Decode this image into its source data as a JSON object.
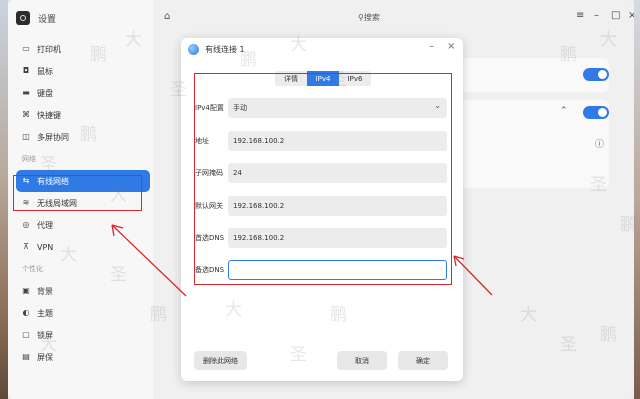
{
  "app": {
    "title": "设置"
  },
  "sidebar": {
    "items": [
      {
        "label": "打印机",
        "icon": "printer-icon",
        "glyph": "▭"
      },
      {
        "label": "鼠标",
        "icon": "mouse-icon",
        "glyph": "◘"
      },
      {
        "label": "键盘",
        "icon": "keyboard-icon",
        "glyph": "▬"
      },
      {
        "label": "快捷键",
        "icon": "shortcut-icon",
        "glyph": "⌘"
      },
      {
        "label": "多屏协同",
        "icon": "multiscreen-icon",
        "glyph": "◫"
      }
    ],
    "group_network": "网络",
    "network_items": [
      {
        "label": "有线网络",
        "icon": "wired-network-icon",
        "glyph": "⇆",
        "active": true
      },
      {
        "label": "无线局域网",
        "icon": "wifi-icon",
        "glyph": "≋"
      },
      {
        "label": "代理",
        "icon": "proxy-icon",
        "glyph": "◎"
      },
      {
        "label": "VPN",
        "icon": "vpn-icon",
        "glyph": "⊼"
      }
    ],
    "group_personal": "个性化",
    "personal_items": [
      {
        "label": "背景",
        "icon": "background-icon",
        "glyph": "▣"
      },
      {
        "label": "主题",
        "icon": "theme-icon",
        "glyph": "◐"
      },
      {
        "label": "锁屏",
        "icon": "lockscreen-icon",
        "glyph": "▢"
      },
      {
        "label": "屏保",
        "icon": "screensaver-icon",
        "glyph": "▤"
      }
    ]
  },
  "topbar": {
    "search_label": "搜索"
  },
  "dialog": {
    "title": "有线连接 1",
    "tabs": [
      "详情",
      "IPv4",
      "IPv6"
    ],
    "selected_tab": "IPv4",
    "fields": [
      {
        "label": "IPv4配置",
        "value": "手动",
        "type": "select"
      },
      {
        "label": "地址",
        "value": "192.168.100.2"
      },
      {
        "label": "子网掩码",
        "value": "24"
      },
      {
        "label": "默认网关",
        "value": "192.168.100.2"
      },
      {
        "label": "首选DNS",
        "value": "192.168.100.2"
      },
      {
        "label": "备选DNS",
        "value": "",
        "active": true
      }
    ],
    "buttons": {
      "delete": "删除此网络",
      "cancel": "取消",
      "ok": "确定"
    }
  },
  "colors": {
    "accent": "#2f7ae5",
    "annotation": "#d8282c"
  },
  "watermark": [
    "鹏",
    "大",
    "圣"
  ]
}
